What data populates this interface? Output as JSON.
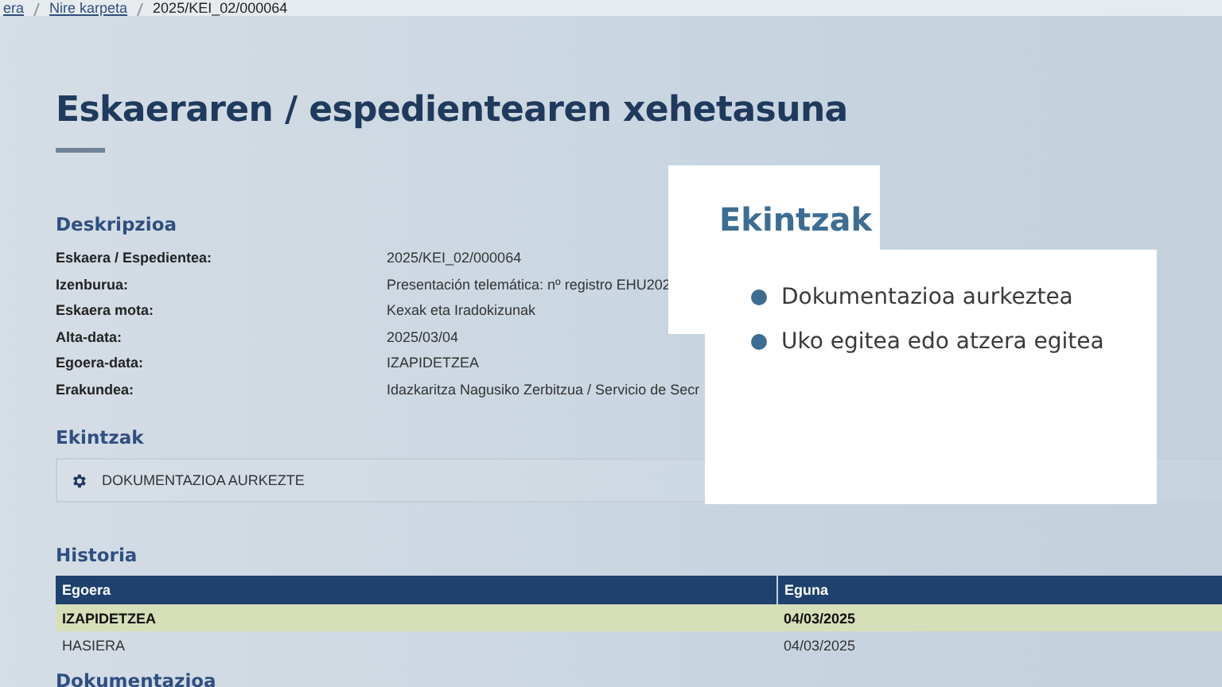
{
  "breadcrumb": [
    {
      "label": "era",
      "link": true
    },
    {
      "label": "Nire karpeta",
      "link": true
    },
    {
      "label": "2025/KEI_02/000064",
      "link": false
    }
  ],
  "page_title": "Eskaeraren / espedientearen xehetasuna",
  "description": {
    "heading": "Deskripzioa",
    "fields": [
      {
        "label": "Eskaera / Espedientea:",
        "value": "2025/KEI_02/000064"
      },
      {
        "label": "Izenburua:",
        "value": "Presentación telemática: nº registro EHU202"
      },
      {
        "label": "Eskaera mota:",
        "value": "Kexak eta Iradokizunak"
      },
      {
        "label": "Alta-data:",
        "value": "2025/03/04"
      },
      {
        "label": "Egoera-data:",
        "value": "IZAPIDETZEA"
      },
      {
        "label": "Erakundea:",
        "value": "Idazkaritza Nagusiko Zerbitzua / Servicio de Secr"
      }
    ]
  },
  "actions": {
    "heading": "Ekintzak",
    "items": [
      {
        "label": "DOKUMENTAZIOA AURKEZTE"
      }
    ]
  },
  "history": {
    "heading": "Historia",
    "columns": [
      "Egoera",
      "Eguna"
    ],
    "rows": [
      {
        "cells": [
          "IZAPIDETZEA",
          "04/03/2025"
        ],
        "selected": true
      },
      {
        "cells": [
          "HASIERA",
          "04/03/2025"
        ],
        "selected": false
      }
    ]
  },
  "documents": {
    "heading": "Dokumentazioa"
  },
  "callout": {
    "title": "Ekintzak",
    "items": [
      "Dokumentazioa aurkeztea",
      "Uko egitea edo atzera egitea"
    ]
  }
}
